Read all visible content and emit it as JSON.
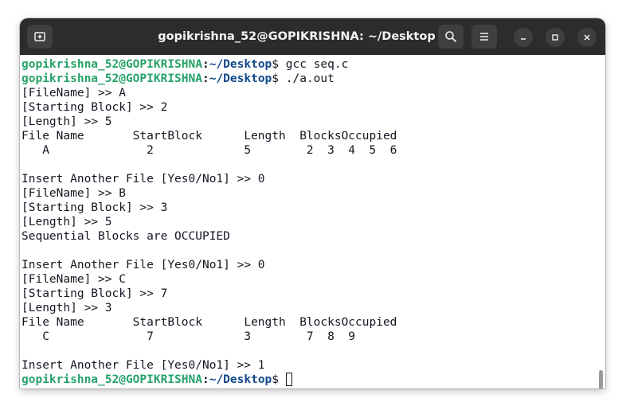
{
  "window": {
    "title": "gopikrishna_52@GOPIKRISHNA: ~/Desktop",
    "icons": {
      "new_tab": "new-tab-icon",
      "search": "search-icon",
      "menu": "hamburger-menu-icon",
      "minimize": "minimize-icon",
      "maximize": "maximize-icon",
      "close": "close-icon"
    }
  },
  "colors": {
    "prompt_host": "#26a269",
    "prompt_path": "#12488b",
    "text": "#171421",
    "titlebar": "#2c2c2c"
  },
  "terminal": {
    "prompt": {
      "user_host": "gopikrishna_52@GOPIKRISHNA",
      "colon": ":",
      "path": "~/Desktop",
      "symbol": "$"
    },
    "lines": [
      {
        "type": "prompt",
        "command": " gcc seq.c"
      },
      {
        "type": "prompt",
        "command": " ./a.out"
      },
      {
        "type": "text",
        "text": "[FileName] >> A"
      },
      {
        "type": "text",
        "text": "[Starting Block] >> 2"
      },
      {
        "type": "text",
        "text": "[Length] >> 5"
      },
      {
        "type": "text",
        "text": "File Name       StartBlock      Length  BlocksOccupied"
      },
      {
        "type": "text",
        "text": "   A              2             5        2  3  4  5  6"
      },
      {
        "type": "text",
        "text": ""
      },
      {
        "type": "text",
        "text": "Insert Another File [Yes0/No1] >> 0"
      },
      {
        "type": "text",
        "text": "[FileName] >> B"
      },
      {
        "type": "text",
        "text": "[Starting Block] >> 3"
      },
      {
        "type": "text",
        "text": "[Length] >> 5"
      },
      {
        "type": "text",
        "text": "Sequential Blocks are OCCUPIED"
      },
      {
        "type": "text",
        "text": ""
      },
      {
        "type": "text",
        "text": "Insert Another File [Yes0/No1] >> 0"
      },
      {
        "type": "text",
        "text": "[FileName] >> C"
      },
      {
        "type": "text",
        "text": "[Starting Block] >> 7"
      },
      {
        "type": "text",
        "text": "[Length] >> 3"
      },
      {
        "type": "text",
        "text": "File Name       StartBlock      Length  BlocksOccupied"
      },
      {
        "type": "text",
        "text": "   C              7             3        7  8  9"
      },
      {
        "type": "text",
        "text": ""
      },
      {
        "type": "text",
        "text": "Insert Another File [Yes0/No1] >> 1"
      },
      {
        "type": "prompt",
        "command": " ",
        "cursor": true
      }
    ]
  }
}
